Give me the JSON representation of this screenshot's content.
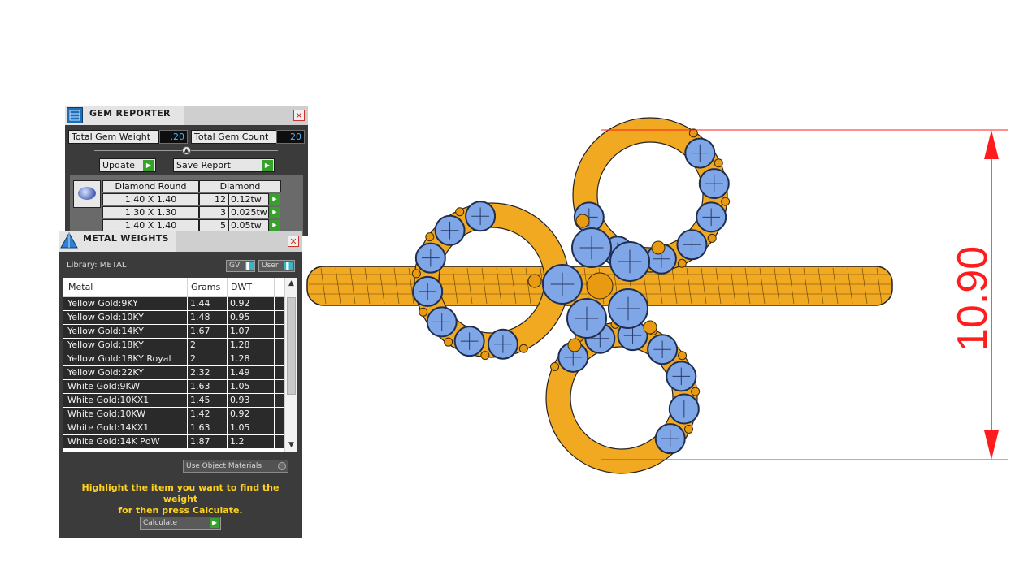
{
  "gem_reporter": {
    "title": "GEM REPORTER",
    "close": "✕",
    "total_weight_label": "Total Gem Weight",
    "total_weight_value": ".20",
    "total_count_label": "Total Gem Count",
    "total_count_value": "20",
    "update_label": "Update",
    "save_report_label": "Save Report",
    "table": {
      "headers": [
        "Diamond Round",
        "Diamond"
      ],
      "rows": [
        {
          "size": "1.40 X 1.40",
          "count": "12",
          "weight": "0.12tw"
        },
        {
          "size": "1.30 X 1.30",
          "count": "3",
          "weight": "0.025tw"
        },
        {
          "size": "1.40 X 1.40",
          "count": "5",
          "weight": "0.05tw"
        }
      ]
    }
  },
  "metal_weights": {
    "title": "METAL WEIGHTS",
    "close": "✕",
    "library_label": "Library: METAL",
    "gv_label": "GV",
    "user_label": "User",
    "columns": [
      "Metal",
      "Grams",
      "DWT"
    ],
    "rows": [
      {
        "metal": "Yellow Gold:9KY",
        "grams": "1.44",
        "dwt": "0.92"
      },
      {
        "metal": "Yellow Gold:10KY",
        "grams": "1.48",
        "dwt": "0.95"
      },
      {
        "metal": "Yellow Gold:14KY",
        "grams": "1.67",
        "dwt": "1.07"
      },
      {
        "metal": "Yellow Gold:18KY",
        "grams": "2",
        "dwt": "1.28"
      },
      {
        "metal": "Yellow Gold:18KY Royal",
        "grams": "2",
        "dwt": "1.28"
      },
      {
        "metal": "Yellow Gold:22KY",
        "grams": "2.32",
        "dwt": "1.49"
      },
      {
        "metal": "White Gold:9KW",
        "grams": "1.63",
        "dwt": "1.05"
      },
      {
        "metal": "White Gold:10KX1",
        "grams": "1.45",
        "dwt": "0.93"
      },
      {
        "metal": "White Gold:10KW",
        "grams": "1.42",
        "dwt": "0.92"
      },
      {
        "metal": "White Gold:14KX1",
        "grams": "1.63",
        "dwt": "1.05"
      },
      {
        "metal": "White Gold:14K PdW",
        "grams": "1.87",
        "dwt": "1.2"
      }
    ],
    "use_object_materials": "Use Object Materials",
    "hint_line1": "Highlight the item you want to find the weight",
    "hint_line2": "for then press Calculate.",
    "calculate_label": "Calculate"
  },
  "viewport": {
    "dimension_value": "10.90",
    "dimension_color": "#ff1c1c",
    "metal_color": "#f2a922",
    "stone_color": "#7fa6e6"
  }
}
